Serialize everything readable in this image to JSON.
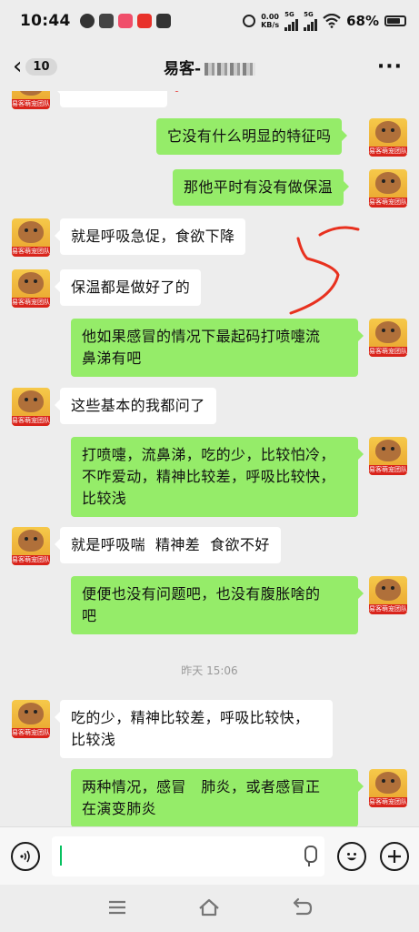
{
  "status_bar": {
    "time": "10:44",
    "net_speed_value": "0.00",
    "net_speed_unit": "KB/s",
    "sig1_label": "5G",
    "sig2_label": "5G",
    "battery_percent": "68%"
  },
  "header": {
    "back_count": "10",
    "title": "易客-",
    "more_label": "···"
  },
  "messages": {
    "m0": "",
    "m1": "它没有什么明显的特征吗",
    "m2": "那他平时有没有做保温",
    "m3": "就是呼吸急促，食欲下降",
    "m4": "保温都是做好了的",
    "m5a": "他如果感冒的情况下最起码打喷嚏流",
    "m5b": "鼻涕有吧",
    "m6": "这些基本的我都问了",
    "m7a": "打喷嚏，流鼻涕，吃的少，比较怕冷，",
    "m7b": "不咋爱动，精神比较差，呼吸比较快，",
    "m7c": "比较浅",
    "m8": "就是呼吸喘  精神差  食欲不好",
    "m9a": "便便也没有问题吧，也没有腹胀啥的",
    "m9b": "吧",
    "timestamp": "昨天 15:06",
    "m10a": "吃的少，精神比较差，呼吸比较快，",
    "m10b": "比较浅",
    "m11a": "两种情况，感冒   肺炎，或者感冒正",
    "m11b": "在演变肺炎"
  },
  "avatar_tag": "易客萌宠团队",
  "input": {
    "value": "",
    "voice_icon": "voice-icon",
    "emoji_icon": "emoji-icon",
    "plus_icon": "plus-icon"
  },
  "colors": {
    "outgoing_bubble": "#95ec69",
    "incoming_bubble": "#ffffff",
    "background": "#ededed",
    "scribble": "#e8311f"
  }
}
